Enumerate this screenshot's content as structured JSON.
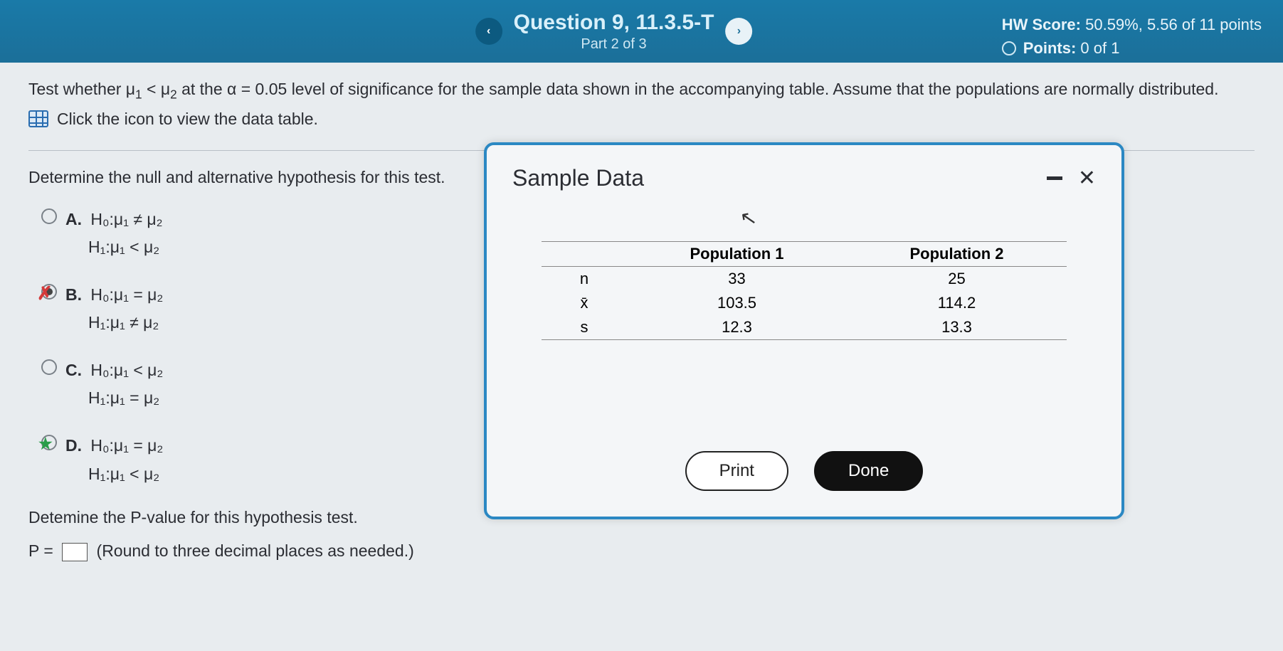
{
  "header": {
    "question_title": "Question 9, 11.3.5-T",
    "part_text": "Part 2 of 3",
    "hw_label": "HW Score:",
    "hw_value": "50.59%, 5.56 of 11 points",
    "points_label": "Points:",
    "points_value": "0 of 1",
    "prev_glyph": "‹",
    "next_glyph": "›"
  },
  "instruction": {
    "line1_pre": "Test whether μ",
    "line1_s1": "1",
    "line1_mid": " < μ",
    "line1_s2": "2",
    "line1_post": " at the α = 0.05 level of significance for the sample data shown in the accompanying table. Assume that the populations are normally distributed.",
    "link_text": "Click the icon to view the data table."
  },
  "prompt": "Determine the null and alternative hypothesis for this test.",
  "options": {
    "A": {
      "label": "A.",
      "h0": "H₀:μ₁ ≠ μ₂",
      "h1": "H₁:μ₁ < μ₂",
      "selected": false,
      "mark": ""
    },
    "B": {
      "label": "B.",
      "h0": "H₀:μ₁ = μ₂",
      "h1": "H₁:μ₁ ≠ μ₂",
      "selected": true,
      "mark": "wrong"
    },
    "C": {
      "label": "C.",
      "h0": "H₀:μ₁ < μ₂",
      "h1": "H₁:μ₁ = μ₂",
      "selected": false,
      "mark": ""
    },
    "D": {
      "label": "D.",
      "h0": "H₀:μ₁ = μ₂",
      "h1": "H₁:μ₁ < μ₂",
      "selected": false,
      "mark": "star"
    }
  },
  "pvalue": {
    "prompt": "Detemine the P-value for this hypothesis test.",
    "prefix": "P = ",
    "suffix": "(Round to three decimal places as needed.)",
    "value": ""
  },
  "dialog": {
    "title": "Sample Data",
    "col1": "Population 1",
    "col2": "Population 2",
    "rows": {
      "n": {
        "label": "n",
        "p1": "33",
        "p2": "25"
      },
      "xbar": {
        "label": "x̄",
        "p1": "103.5",
        "p2": "114.2"
      },
      "s": {
        "label": "s",
        "p1": "12.3",
        "p2": "13.3"
      }
    },
    "print": "Print",
    "done": "Done"
  },
  "chart_data": {
    "type": "table",
    "title": "Sample Data",
    "columns": [
      "",
      "Population 1",
      "Population 2"
    ],
    "rows": [
      [
        "n",
        33,
        25
      ],
      [
        "x̄",
        103.5,
        114.2
      ],
      [
        "s",
        12.3,
        13.3
      ]
    ]
  }
}
